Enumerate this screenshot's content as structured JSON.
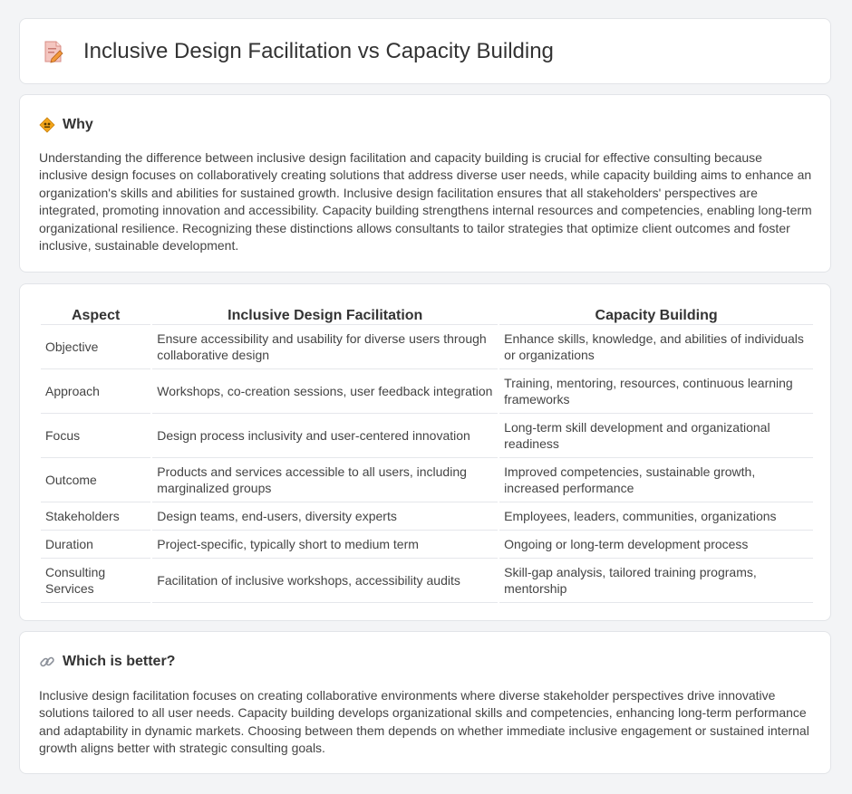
{
  "header": {
    "title": "Inclusive Design Facilitation vs Capacity Building",
    "icon": "document-pencil-icon"
  },
  "why": {
    "icon": "warning-sign-icon",
    "title": "Why",
    "text": "Understanding the difference between inclusive design facilitation and capacity building is crucial for effective consulting because inclusive design focuses on collaboratively creating solutions that address diverse user needs, while capacity building aims to enhance an organization's skills and abilities for sustained growth. Inclusive design facilitation ensures that all stakeholders' perspectives are integrated, promoting innovation and accessibility. Capacity building strengthens internal resources and competencies, enabling long-term organizational resilience. Recognizing these distinctions allows consultants to tailor strategies that optimize client outcomes and foster inclusive, sustainable development."
  },
  "table": {
    "headers": [
      "Aspect",
      "Inclusive Design Facilitation",
      "Capacity Building"
    ],
    "rows": [
      [
        "Objective",
        "Ensure accessibility and usability for diverse users through collaborative design",
        "Enhance skills, knowledge, and abilities of individuals or organizations"
      ],
      [
        "Approach",
        "Workshops, co-creation sessions, user feedback integration",
        "Training, mentoring, resources, continuous learning frameworks"
      ],
      [
        "Focus",
        "Design process inclusivity and user-centered innovation",
        "Long-term skill development and organizational readiness"
      ],
      [
        "Outcome",
        "Products and services accessible to all users, including marginalized groups",
        "Improved competencies, sustainable growth, increased performance"
      ],
      [
        "Stakeholders",
        "Design teams, end-users, diversity experts",
        "Employees, leaders, communities, organizations"
      ],
      [
        "Duration",
        "Project-specific, typically short to medium term",
        "Ongoing or long-term development process"
      ],
      [
        "Consulting Services",
        "Facilitation of inclusive workshops, accessibility audits",
        "Skill-gap analysis, tailored training programs, mentorship"
      ]
    ]
  },
  "better": {
    "icon": "link-icon",
    "title": "Which is better?",
    "text": "Inclusive design facilitation focuses on creating collaborative environments where diverse stakeholder perspectives drive innovative solutions tailored to all user needs. Capacity building develops organizational skills and competencies, enhancing long-term performance and adaptability in dynamic markets. Choosing between them depends on whether immediate inclusive engagement or sustained internal growth aligns better with strategic consulting goals."
  }
}
